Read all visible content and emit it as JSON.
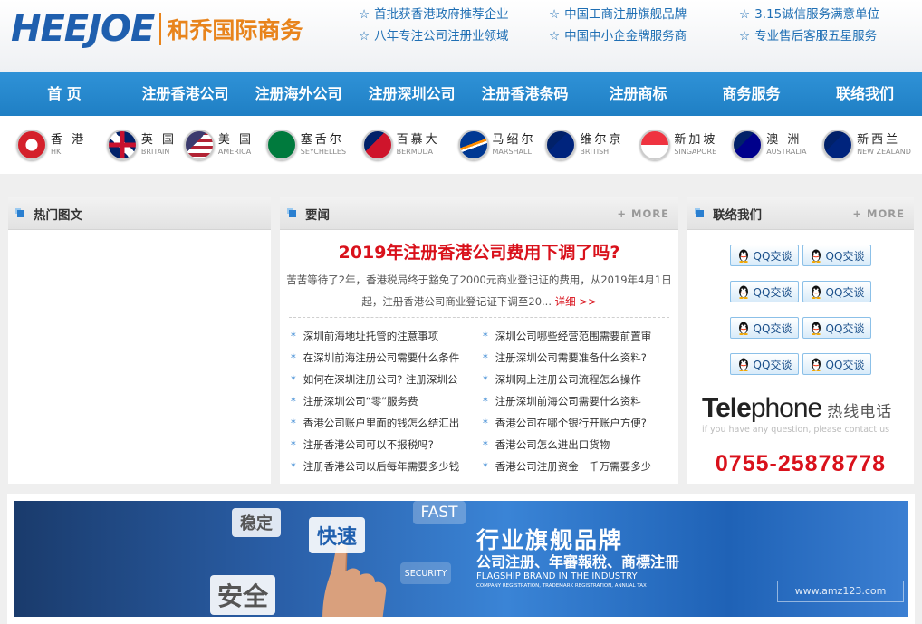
{
  "header": {
    "logo_en": "HEEJOE",
    "logo_cn": "和乔国际商务",
    "slogans": [
      "首批获香港政府推荐企业",
      "中国工商注册旗舰品牌",
      "3.15诚信服务满意单位",
      "八年专注公司注册业领域",
      "中国中小企金牌服务商",
      "专业售后客服五星服务"
    ],
    "star": "☆"
  },
  "nav": {
    "items": [
      "首 页",
      "注册香港公司",
      "注册海外公司",
      "注册深圳公司",
      "注册香港条码",
      "注册商标",
      "商务服务",
      "联络我们"
    ]
  },
  "flags": [
    {
      "cn": "香 港",
      "en": "HK"
    },
    {
      "cn": "英 国",
      "en": "BRITAIN"
    },
    {
      "cn": "美 国",
      "en": "AMERICA"
    },
    {
      "cn": "塞舌尔",
      "en": "SEYCHELLES"
    },
    {
      "cn": "百慕大",
      "en": "BERMUDA"
    },
    {
      "cn": "马绍尔",
      "en": "MARSHALL"
    },
    {
      "cn": "维尔京",
      "en": "BRITISH"
    },
    {
      "cn": "新加坡",
      "en": "SINGAPORE"
    },
    {
      "cn": "澳 洲",
      "en": "AUSTRALIA"
    },
    {
      "cn": "新西兰",
      "en": "NEW ZEALAND"
    }
  ],
  "hot": {
    "title": "热门图文"
  },
  "news": {
    "title": "要闻",
    "more": "+ MORE",
    "headline": "2019年注册香港公司费用下调了吗?",
    "summary": "苦苦等待了2年，香港税局终于豁免了2000元商业登记证的费用，从2019年4月1日起，注册香港公司商业登记证下调至20...",
    "detail": "详细 >>",
    "bullet": "*",
    "items": [
      "深圳前海地址托管的注意事项",
      "深圳公司哪些经营范围需要前置审",
      "在深圳前海注册公司需要什么条件",
      "注册深圳公司需要准备什么资料?",
      "如何在深圳注册公司? 注册深圳公",
      "深圳网上注册公司流程怎么操作",
      "注册深圳公司“零”服务费",
      "注册深圳前海公司需要什么资料",
      "香港公司账户里面的钱怎么结汇出",
      "香港公司在哪个银行开账户方便?",
      "注册香港公司可以不报税吗?",
      "香港公司怎么进出口货物",
      "注册香港公司以后每年需要多少钱",
      "香港公司注册资金一千万需要多少"
    ]
  },
  "contact": {
    "title": "联络我们",
    "more": "+ MORE",
    "qq_label": "QQ交谈",
    "qq_count": 8,
    "tele_a": "Tele",
    "tele_b": "phone",
    "tele_cn": "热线电话",
    "tele_sub": "if you have any question, please contact us",
    "phone": "0755-25878778"
  },
  "banner": {
    "tiles": [
      "稳定",
      "快速",
      "FAST",
      "SECURITY",
      "安全"
    ],
    "headline": "行业旗舰品牌",
    "sub": "公司注册、年審報稅、商標注冊",
    "en1": "FLAGSHIP BRAND IN THE INDUSTRY",
    "en2": "COMPANY REGISTRATION, TRADEMARK REGISTRATION, ANNUAL TAX",
    "watermark": "www.amz123.com"
  }
}
